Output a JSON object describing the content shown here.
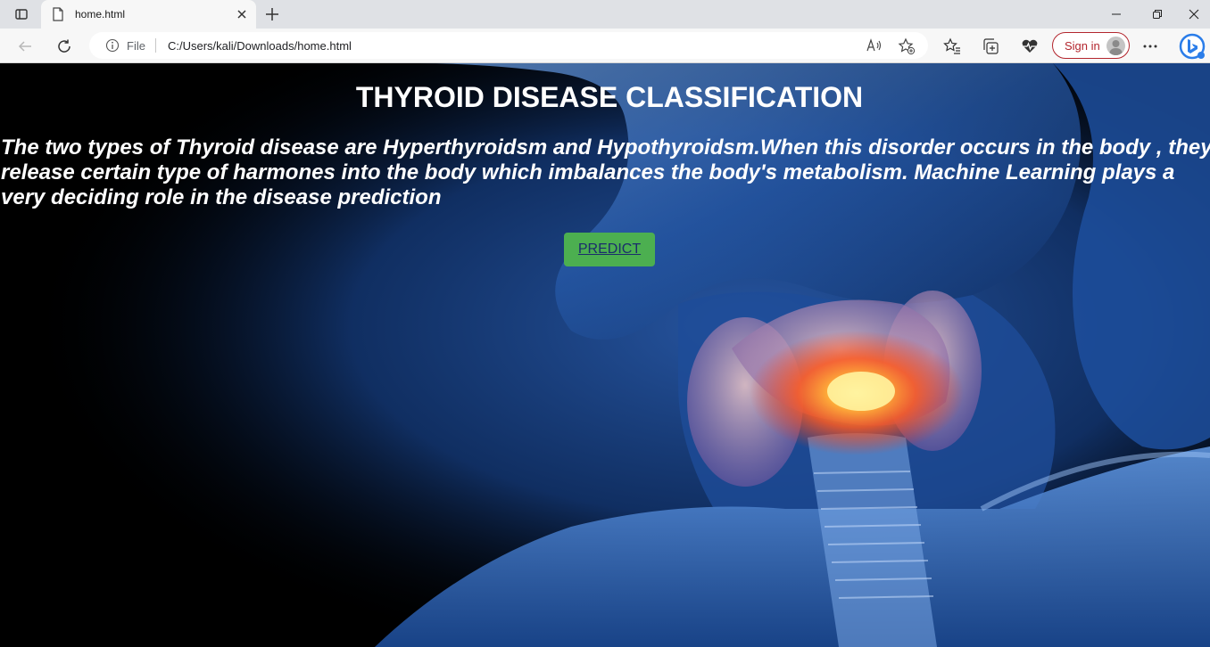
{
  "browser": {
    "tab_title": "home.html",
    "address": {
      "scheme_label": "File",
      "url": "C:/Users/kali/Downloads/home.html"
    },
    "signin_label": "Sign in",
    "accent_color": "#b3262e"
  },
  "page": {
    "title": "THYROID DISEASE CLASSIFICATION",
    "description": "The two types of Thyroid disease are Hyperthyroidsm and Hypothyroidsm.When this disorder occurs in the body , they release certain type of harmones into the body which imbalances the body's metabolism. Machine Learning plays a very deciding role in the disease prediction",
    "predict_label": "PREDICT",
    "button_color": "#4caf50"
  }
}
